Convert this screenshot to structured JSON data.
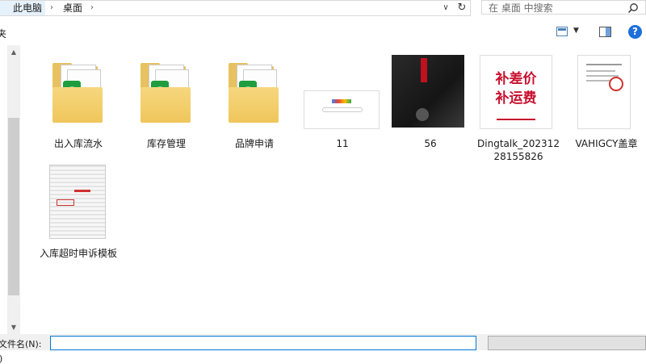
{
  "address": {
    "crumbs": [
      "此电脑",
      "桌面"
    ],
    "sep": "›"
  },
  "search": {
    "placeholder": "在 桌面 中搜索"
  },
  "toolbar": {
    "left_fragment": "夹"
  },
  "nav": {
    "frag1": "",
    "frag2": ")"
  },
  "items": [
    {
      "label": "出入库流水",
      "kind": "folder"
    },
    {
      "label": "库存管理",
      "kind": "folder"
    },
    {
      "label": "品牌申请",
      "kind": "folder"
    },
    {
      "label": "11",
      "kind": "image"
    },
    {
      "label": "56",
      "kind": "image"
    },
    {
      "label": "Dingtalk_20231228155826",
      "kind": "image",
      "lines": [
        "补差价",
        "补运费"
      ]
    },
    {
      "label": "VAHIGCY盖章",
      "kind": "image"
    },
    {
      "label": "入库超时申诉模板",
      "kind": "image"
    }
  ],
  "bottom": {
    "filename_label": "文件名(N):",
    "filetype": ""
  },
  "colors": {
    "accent": "#0078d7",
    "folder": "#efc65b",
    "badge": "#1f9d3f",
    "red_text": "#c8102e"
  }
}
